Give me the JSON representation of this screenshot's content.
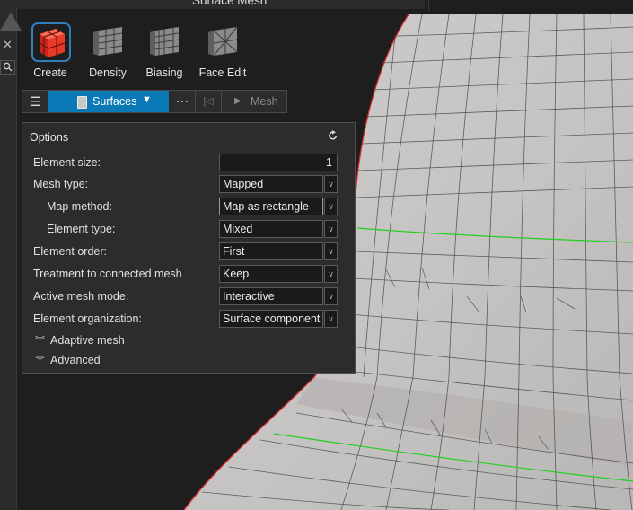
{
  "topbar": {
    "title": "Surface Mesh"
  },
  "leftstrip": {
    "close_glyph": "✕",
    "search_icon": "search-icon"
  },
  "ribbon": {
    "tools": [
      {
        "label": "Create",
        "icon": "create-mesh-icon",
        "active": true
      },
      {
        "label": "Density",
        "icon": "density-icon",
        "active": false
      },
      {
        "label": "Biasing",
        "icon": "biasing-icon",
        "active": false
      },
      {
        "label": "Face Edit",
        "icon": "face-edit-icon",
        "active": false
      }
    ]
  },
  "toolbar": {
    "menu_glyph": "☰",
    "selector_label": "Surfaces",
    "more_glyph": "···",
    "first_glyph": "|◁",
    "run_label": "Mesh"
  },
  "options": {
    "title": "Options",
    "fields": [
      {
        "label": "Element size:",
        "value": "1",
        "type": "number"
      },
      {
        "label": "Mesh type:",
        "value": "Mapped",
        "type": "select"
      },
      {
        "label": "Map method:",
        "value": "Map as rectangle",
        "type": "select"
      },
      {
        "label": "Element type:",
        "value": "Mixed",
        "type": "select"
      },
      {
        "label": "Element order:",
        "value": "First",
        "type": "select"
      },
      {
        "label": "Treatment to connected mesh",
        "value": "Keep",
        "type": "select"
      },
      {
        "label": "Active mesh mode:",
        "value": "Interactive",
        "type": "select"
      },
      {
        "label": "Element organization:",
        "value": "Surface component",
        "type": "select"
      }
    ],
    "sections": [
      {
        "label": "Adaptive mesh"
      },
      {
        "label": "Advanced"
      }
    ]
  },
  "colors": {
    "accent": "#0b79b6",
    "panel_bg": "#2c2c2c",
    "mesh_surface": "#c9c7c5",
    "mesh_edge": "#d42a2a",
    "feature_line": "#1fd01f"
  }
}
